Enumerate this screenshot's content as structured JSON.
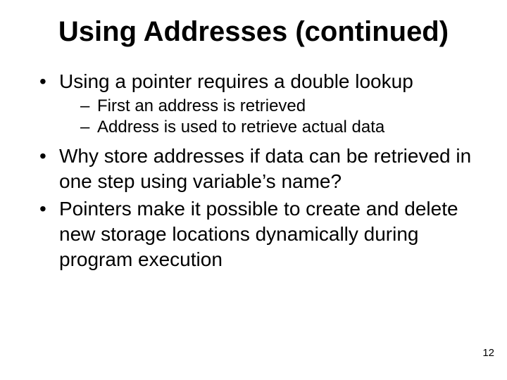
{
  "title": "Using Addresses (continued)",
  "bullets": {
    "b1": "Using a pointer requires a double lookup",
    "b1a": "First an address is retrieved",
    "b1b": "Address is used to retrieve actual data",
    "b2": "Why store addresses if data can be retrieved in one step using variable’s name?",
    "b3": "Pointers make it possible to create and delete new storage locations dynamically during program execution"
  },
  "page_number": "12"
}
